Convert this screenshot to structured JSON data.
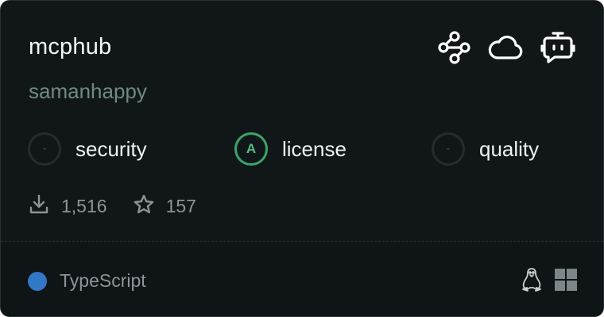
{
  "package": {
    "name": "mcphub",
    "author": "samanhappy"
  },
  "capability_icons": [
    "workflow-icon",
    "cloud-icon",
    "bot-icon"
  ],
  "metrics": [
    {
      "grade": "-",
      "label": "security",
      "state": "none"
    },
    {
      "grade": "A",
      "label": "license",
      "state": "good"
    },
    {
      "grade": "-",
      "label": "quality",
      "state": "none"
    }
  ],
  "stats": {
    "downloads": "1,516",
    "stars": "157"
  },
  "footer": {
    "language": "TypeScript",
    "language_color": "#3178c6",
    "platform_icons": [
      "linux-icon",
      "windows-icon"
    ]
  },
  "colors": {
    "background": "#111719",
    "grade_good": "#3aa56a",
    "author": "#6f8a82"
  }
}
